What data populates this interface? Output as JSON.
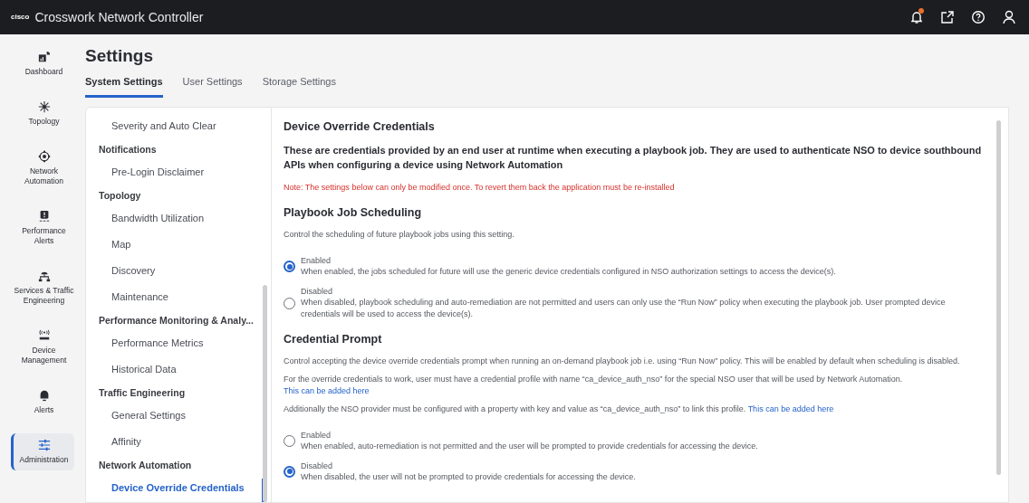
{
  "header": {
    "logo": "cisco",
    "title": "Crosswork Network Controller",
    "notification_dot": true
  },
  "rail": [
    {
      "label": "Dashboard",
      "selected": false
    },
    {
      "label": "Topology",
      "selected": false
    },
    {
      "label": "Network Automation",
      "selected": false
    },
    {
      "label": "Performance Alerts",
      "selected": false
    },
    {
      "label": "Services & Traffic Engineering",
      "selected": false
    },
    {
      "label": "Device Management",
      "selected": false
    },
    {
      "label": "Alerts",
      "selected": false
    },
    {
      "label": "Administration",
      "selected": true
    }
  ],
  "page_title": "Settings",
  "tabs": [
    {
      "label": "System Settings",
      "selected": true
    },
    {
      "label": "User Settings",
      "selected": false
    },
    {
      "label": "Storage Settings",
      "selected": false
    }
  ],
  "nav": [
    {
      "kind": "item",
      "label": "Severity and Auto Clear",
      "selected": false
    },
    {
      "kind": "group",
      "label": "Notifications"
    },
    {
      "kind": "item",
      "label": "Pre-Login Disclaimer",
      "selected": false
    },
    {
      "kind": "group",
      "label": "Topology"
    },
    {
      "kind": "item",
      "label": "Bandwidth Utilization",
      "selected": false
    },
    {
      "kind": "item",
      "label": "Map",
      "selected": false
    },
    {
      "kind": "item",
      "label": "Discovery",
      "selected": false
    },
    {
      "kind": "item",
      "label": "Maintenance",
      "selected": false
    },
    {
      "kind": "group",
      "label": "Performance Monitoring & Analy..."
    },
    {
      "kind": "item",
      "label": "Performance Metrics",
      "selected": false
    },
    {
      "kind": "item",
      "label": "Historical Data",
      "selected": false
    },
    {
      "kind": "group",
      "label": "Traffic Engineering"
    },
    {
      "kind": "item",
      "label": "General Settings",
      "selected": false
    },
    {
      "kind": "item",
      "label": "Affinity",
      "selected": false
    },
    {
      "kind": "group",
      "label": "Network Automation"
    },
    {
      "kind": "item",
      "label": "Device Override Credentials",
      "selected": true
    }
  ],
  "content": {
    "title": "Device Override Credentials",
    "lead": "These are credentials provided by an end user at runtime when executing a playbook job. They are used to authenticate NSO to device southbound APIs when configuring a device using Network Automation",
    "note": "Note: The settings below can only be modified once. To revert them back the application must be re-installed",
    "sections": [
      {
        "title": "Playbook Job Scheduling",
        "paragraphs": [
          {
            "text": "Control the scheduling of future playbook jobs using this setting."
          }
        ],
        "options": [
          {
            "label": "Enabled",
            "description": "When enabled, the jobs scheduled for future will use the generic device credentials configured in NSO authorization settings to access the device(s).",
            "selected": true
          },
          {
            "label": "Disabled",
            "description": "When disabled, playbook scheduling and auto-remediation are not permitted and users can only use the “Run Now” policy when executing the playbook job. User prompted device credentials will be used to access the device(s).",
            "selected": false
          }
        ]
      },
      {
        "title": "Credential Prompt",
        "paragraphs": [
          {
            "text": "Control accepting the device override credentials prompt when running an on-demand playbook job i.e. using “Run Now” policy. This will be enabled by default when scheduling is disabled."
          },
          {
            "text": "For the override credentials to work, user must have a credential profile with name “ca_device_auth_nso” for the special NSO user that will be used by Network Automation.",
            "link": "This can be added here"
          },
          {
            "text": "Additionally the NSO provider must be configured with a property with key and value as “ca_device_auth_nso” to link this profile.",
            "link": "This can be added here"
          }
        ],
        "options": [
          {
            "label": "Enabled",
            "description": "When enabled, auto-remediation is not permitted and the user will be prompted to provide credentials for accessing the device.",
            "selected": false
          },
          {
            "label": "Disabled",
            "description": "When disabled, the user will not be prompted to provide credentials for accessing the device.",
            "selected": true
          }
        ]
      }
    ]
  }
}
